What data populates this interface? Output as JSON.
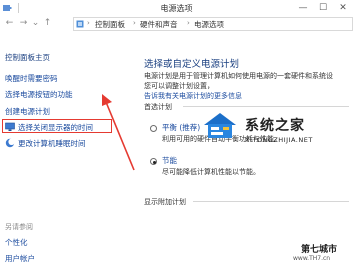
{
  "window": {
    "title": "电源选项",
    "buttons": {
      "minimize": "—",
      "maximize": "☐",
      "close": "✕"
    }
  },
  "address": {
    "back": "←",
    "forward": "→",
    "recent": "⌄",
    "up": "↑",
    "crumbs": [
      "控制面板",
      "硬件和声音",
      "电源选项"
    ]
  },
  "sidebar": {
    "items": [
      {
        "label": "控制面板主页"
      },
      {
        "label": "唤醒时需要密码"
      },
      {
        "label": "选择电源按钮的功能"
      },
      {
        "label": "创建电源计划"
      },
      {
        "label": "选择关闭显示器的时间"
      },
      {
        "label": "更改计算机睡眠时间"
      }
    ],
    "see_also_title": "另请参阅",
    "see_also": [
      {
        "label": "个性化"
      },
      {
        "label": "用户帐户"
      }
    ]
  },
  "main": {
    "heading": "选择或自定义电源计划",
    "description_line1": "电源计划是用于管理计算机如何使用电源的一套硬件和系统设",
    "description_line2": "您可以调整计划设置，",
    "description_link": "告诉我有关电源计划的更多信息",
    "preferred_label": "首选计划",
    "plans": [
      {
        "name": "平衡 (推荐)",
        "desc": "利用可用的硬件自动平衡功耗与性能。",
        "selected": false
      },
      {
        "name": "节能",
        "desc": "尽可能降低计算机性能以节能。",
        "selected": true
      }
    ],
    "additional_label": "显示附加计划"
  },
  "watermark": {
    "brand": "系统之家",
    "url": "XITONGZHIJIA.NET",
    "corner": "第七城市",
    "corner_url": "www.TH7.cn"
  },
  "colors": {
    "link": "#1a4a9e",
    "heading": "#1a3f80",
    "highlight": "#e53a31"
  }
}
